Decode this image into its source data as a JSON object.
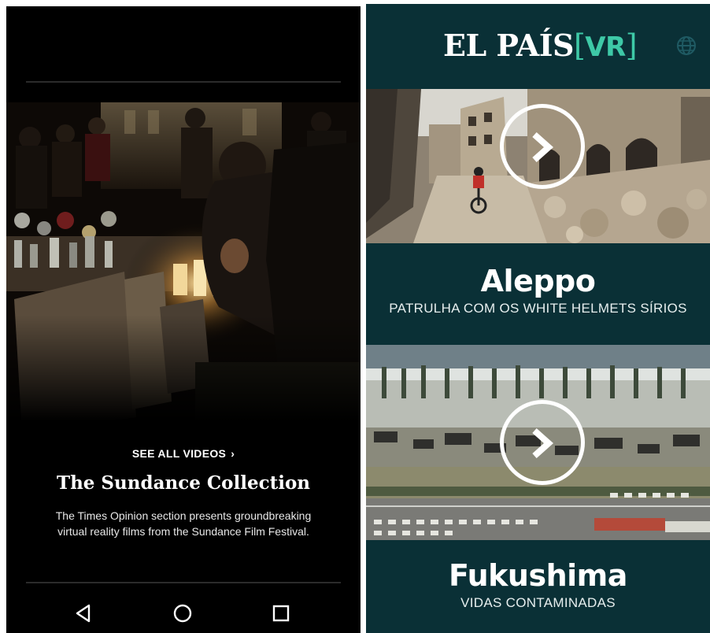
{
  "left_app": {
    "see_all_label": "SEE ALL VIDEOS",
    "see_all_chevron": "›",
    "collection_title": "The Sundance Collection",
    "collection_description": "The Times Opinion section presents groundbreaking virtual reality films from the Sundance Film Festival.",
    "nav": {
      "back_icon": "back-triangle-icon",
      "home_icon": "home-circle-icon",
      "recents_icon": "recents-square-icon"
    }
  },
  "right_app": {
    "logo_text": "EL PAÍS",
    "logo_bracket_open": "[",
    "logo_vr": "VR",
    "logo_bracket_close": "]",
    "accent_color": "#3ec9a7",
    "background_color": "#0a3036",
    "cards": [
      {
        "title": "Aleppo",
        "subtitle": "PATRULHA COM OS WHITE HELMETS SÍRIOS"
      },
      {
        "title": "Fukushima",
        "subtitle": "VIDAS CONTAMINADAS"
      }
    ]
  }
}
